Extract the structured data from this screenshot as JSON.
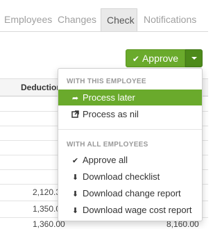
{
  "tabs": [
    {
      "label": "Employees"
    },
    {
      "label": "Changes"
    },
    {
      "label": "Check"
    },
    {
      "label": "Notifications"
    }
  ],
  "approve": {
    "label": "Approve"
  },
  "table": {
    "header": "Deductions",
    "rows": [
      {
        "deductions": "2,120.3"
      },
      {
        "deductions": "1,350.0"
      },
      {
        "deductions": "1,360.00",
        "extra": "8,160.00"
      }
    ]
  },
  "menu": {
    "section1_header": "WITH THIS EMPLOYEE",
    "section1_items": [
      {
        "label": "Process later",
        "icon": "share-arrow-icon"
      },
      {
        "label": "Process as nil",
        "icon": "external-link-icon"
      }
    ],
    "section2_header": "WITH ALL EMPLOYEES",
    "section2_items": [
      {
        "label": "Approve all",
        "icon": "checkmark-icon"
      },
      {
        "label": "Download checklist",
        "icon": "download-icon"
      },
      {
        "label": "Download change report",
        "icon": "download-icon"
      },
      {
        "label": "Download wage cost report",
        "icon": "download-icon"
      }
    ]
  },
  "colors": {
    "accent": "#6aaa2c",
    "accent_dark": "#4d8a1a"
  }
}
